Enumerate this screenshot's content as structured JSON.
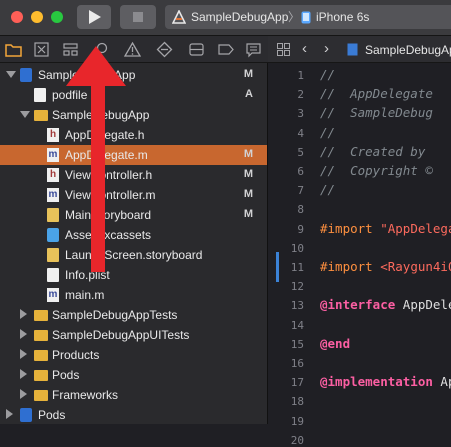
{
  "toolbar": {
    "scheme_target": "SampleDebugApp",
    "device": "iPhone 6s"
  },
  "navigator": {
    "rows": [
      {
        "label": "SampleDebugApp",
        "status": "M",
        "icon": "project-icon",
        "depth": 0,
        "disclosure": "open"
      },
      {
        "label": "podfile",
        "status": "A",
        "icon": "file-icon",
        "depth": 1,
        "disclosure": "none"
      },
      {
        "label": "SampleDebugApp",
        "status": "",
        "icon": "folder-icon",
        "depth": 1,
        "disclosure": "open"
      },
      {
        "label": "AppDelegate.h",
        "status": "",
        "icon": "header-file-icon",
        "depth": 2,
        "disclosure": "none"
      },
      {
        "label": "AppDelegate.m",
        "status": "M",
        "icon": "objc-file-icon",
        "depth": 2,
        "disclosure": "none",
        "selected": true
      },
      {
        "label": "ViewController.h",
        "status": "M",
        "icon": "header-file-icon",
        "depth": 2,
        "disclosure": "none"
      },
      {
        "label": "ViewController.m",
        "status": "M",
        "icon": "objc-file-icon",
        "depth": 2,
        "disclosure": "none"
      },
      {
        "label": "Main.storyboard",
        "status": "M",
        "icon": "storyboard-icon",
        "depth": 2,
        "disclosure": "none"
      },
      {
        "label": "Assets.xcassets",
        "status": "",
        "icon": "assets-icon",
        "depth": 2,
        "disclosure": "none"
      },
      {
        "label": "LaunchScreen.storyboard",
        "status": "",
        "icon": "storyboard-icon",
        "depth": 2,
        "disclosure": "none"
      },
      {
        "label": "Info.plist",
        "status": "",
        "icon": "file-icon",
        "depth": 2,
        "disclosure": "none"
      },
      {
        "label": "main.m",
        "status": "",
        "icon": "objc-file-icon",
        "depth": 2,
        "disclosure": "none"
      },
      {
        "label": "SampleDebugAppTests",
        "status": "",
        "icon": "folder-icon",
        "depth": 1,
        "disclosure": "closed"
      },
      {
        "label": "SampleDebugAppUITests",
        "status": "",
        "icon": "folder-icon",
        "depth": 1,
        "disclosure": "closed"
      },
      {
        "label": "Products",
        "status": "",
        "icon": "folder-icon",
        "depth": 1,
        "disclosure": "closed"
      },
      {
        "label": "Pods",
        "status": "",
        "icon": "folder-icon",
        "depth": 1,
        "disclosure": "closed"
      },
      {
        "label": "Frameworks",
        "status": "",
        "icon": "folder-icon",
        "depth": 1,
        "disclosure": "closed"
      },
      {
        "label": "Pods",
        "status": "",
        "icon": "project-icon",
        "depth": 0,
        "disclosure": "closed"
      }
    ]
  },
  "editor": {
    "breadcrumb_file": "SampleDebugApp",
    "lines": [
      {
        "n": "1",
        "segs": [
          {
            "t": "//",
            "c": "comment"
          }
        ]
      },
      {
        "n": "2",
        "segs": [
          {
            "t": "//  AppDelegate",
            "c": "comment"
          }
        ]
      },
      {
        "n": "3",
        "segs": [
          {
            "t": "//  SampleDebug",
            "c": "comment"
          }
        ]
      },
      {
        "n": "4",
        "segs": [
          {
            "t": "//",
            "c": "comment"
          }
        ]
      },
      {
        "n": "5",
        "segs": [
          {
            "t": "//  Created by",
            "c": "comment"
          }
        ]
      },
      {
        "n": "6",
        "segs": [
          {
            "t": "//  Copyright ©",
            "c": "comment"
          }
        ]
      },
      {
        "n": "7",
        "segs": [
          {
            "t": "//",
            "c": "comment"
          }
        ]
      },
      {
        "n": "8",
        "segs": []
      },
      {
        "n": "9",
        "segs": [
          {
            "t": "#import ",
            "c": "pre"
          },
          {
            "t": "\"AppDelega",
            "c": "str"
          }
        ]
      },
      {
        "n": "10",
        "segs": []
      },
      {
        "n": "11",
        "segs": [
          {
            "t": "#import ",
            "c": "pre"
          },
          {
            "t": "<Raygun4iO",
            "c": "str"
          }
        ]
      },
      {
        "n": "12",
        "segs": []
      },
      {
        "n": "13",
        "segs": [
          {
            "t": "@interface ",
            "c": "kw"
          },
          {
            "t": "AppDele",
            "c": "plain"
          }
        ]
      },
      {
        "n": "14",
        "segs": []
      },
      {
        "n": "15",
        "segs": [
          {
            "t": "@end",
            "c": "kw"
          }
        ]
      },
      {
        "n": "16",
        "segs": []
      },
      {
        "n": "17",
        "segs": [
          {
            "t": "@implementation ",
            "c": "kw"
          },
          {
            "t": "Ap",
            "c": "plain"
          }
        ]
      },
      {
        "n": "18",
        "segs": []
      },
      {
        "n": "19",
        "segs": []
      },
      {
        "n": "20",
        "segs": [
          {
            "t": "- (",
            "c": "plain"
          },
          {
            "t": "BOOL",
            "c": "kw"
          },
          {
            "t": ")applicati",
            "c": "plain"
          }
        ]
      }
    ]
  },
  "colors": {
    "selection": "#c8672f",
    "annotation_arrow": "#e8262b"
  }
}
